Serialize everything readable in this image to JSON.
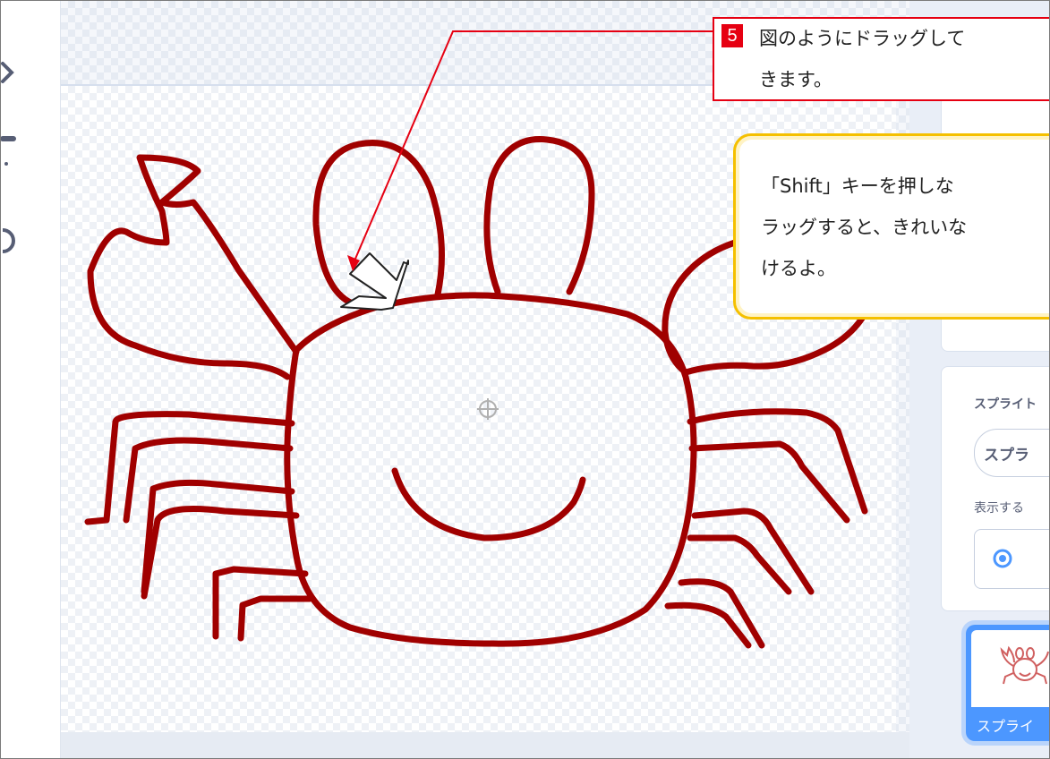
{
  "step": {
    "number": "5",
    "line1": "図のようにドラッグして",
    "line2": "きます。"
  },
  "tip": {
    "line1": "「Shift」キーを押しな",
    "line2": "ラッグすると、きれいな",
    "line3": "けるよ。"
  },
  "sprite_panel": {
    "label": "スプライト",
    "name_value": "スプラ",
    "show_label": "表示する",
    "tile_name": "スプライ"
  },
  "icons": [
    "tool-arrow-icon",
    "tool-line-icon",
    "tool-circle-icon",
    "eye-icon",
    "rotation-center-icon",
    "drag-arrow-icon",
    "crab-thumbnail-icon"
  ],
  "colors": {
    "accent_red": "#e60012",
    "tip_yellow": "#f5c000",
    "drawing_stroke": "#a00000",
    "sprite_tile": "#4c97ff"
  }
}
